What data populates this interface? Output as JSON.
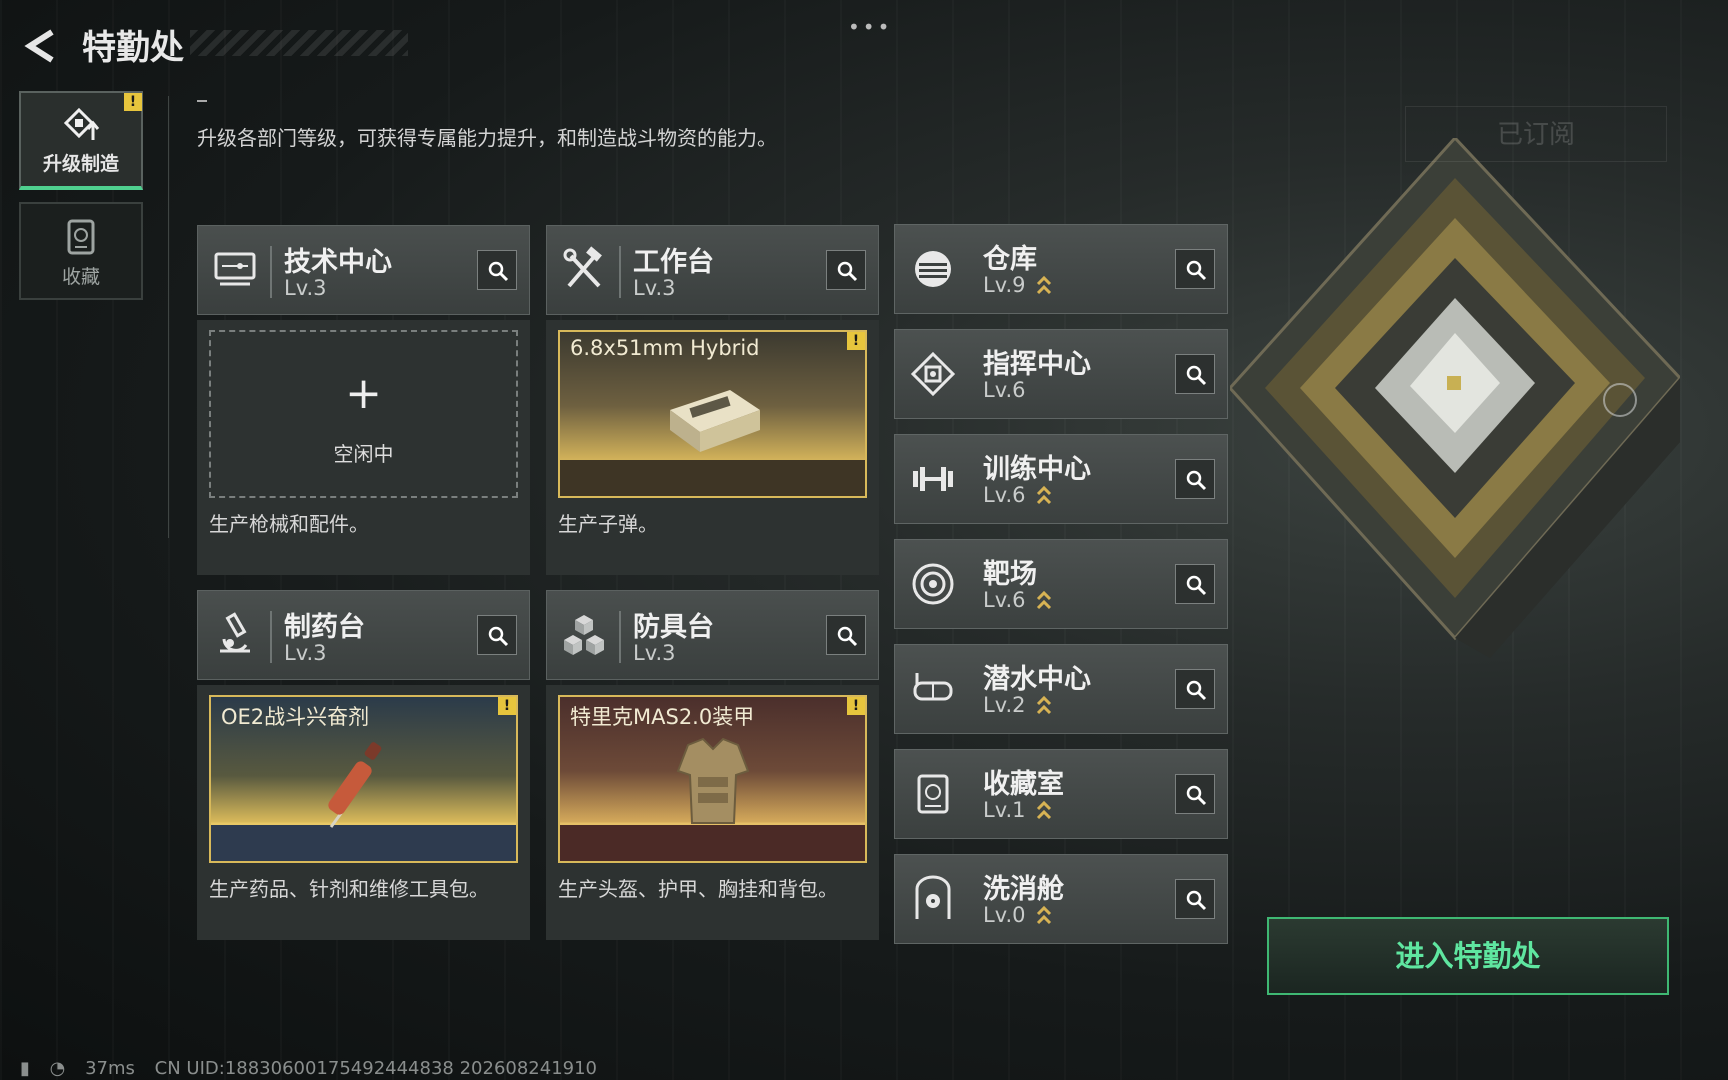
{
  "header": {
    "title": "特勤处",
    "menu_dots": "•••"
  },
  "nav": {
    "items": [
      {
        "label": "升级制造",
        "icon": "upgrade-craft-icon",
        "active": true,
        "badge": "!"
      },
      {
        "label": "收藏",
        "icon": "collection-icon",
        "active": false
      }
    ]
  },
  "description": "升级各部门等级，可获得专属能力提升，和制造战斗物资的能力。",
  "subscribed_label": "已订阅",
  "facilities": {
    "tech": {
      "name": "技术中心",
      "level": "Lv.3",
      "icon": "monitor-icon",
      "status_label": "空闲中",
      "caption": "生产枪械和配件。"
    },
    "workbench": {
      "name": "工作台",
      "level": "Lv.3",
      "icon": "hammer-wrench-icon",
      "product": "6.8x51mm Hybrid",
      "badge": "!",
      "caption": "生产子弹。"
    },
    "pharmacy": {
      "name": "制药台",
      "level": "Lv.3",
      "icon": "microscope-icon",
      "product": "OE2战斗兴奋剂",
      "badge": "!",
      "caption": "生产药品、针剂和维修工具包。"
    },
    "armory": {
      "name": "防具台",
      "level": "Lv.3",
      "icon": "armor-blocks-icon",
      "product": "特里克MAS2.0装甲",
      "badge": "!",
      "caption": "生产头盔、护甲、胸挂和背包。"
    }
  },
  "side_facilities": [
    {
      "name": "仓库",
      "level": "Lv.9",
      "icon": "warehouse-icon",
      "upgradable": true
    },
    {
      "name": "指挥中心",
      "level": "Lv.6",
      "icon": "command-chip-icon",
      "upgradable": false
    },
    {
      "name": "训练中心",
      "level": "Lv.6",
      "icon": "dumbbell-icon",
      "upgradable": true
    },
    {
      "name": "靶场",
      "level": "Lv.6",
      "icon": "target-icon",
      "upgradable": true
    },
    {
      "name": "潜水中心",
      "level": "Lv.2",
      "icon": "diving-mask-icon",
      "upgradable": true
    },
    {
      "name": "收藏室",
      "level": "Lv.1",
      "icon": "collection-room-icon",
      "upgradable": true
    },
    {
      "name": "洗消舱",
      "level": "Lv.0",
      "icon": "decon-pod-icon",
      "upgradable": true
    }
  ],
  "enter_button": "进入特勤处",
  "footer": {
    "ping": "37ms",
    "uid": "CN UID:18830600175492444838 202608241910"
  },
  "colors": {
    "accent_green": "#3fb873",
    "gold": "#d8b95a",
    "warning": "#e7c53d"
  }
}
